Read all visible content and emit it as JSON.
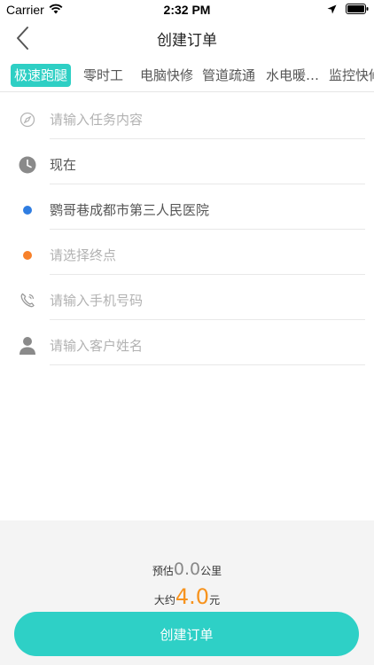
{
  "status_bar": {
    "carrier": "Carrier",
    "time": "2:32 PM"
  },
  "nav": {
    "title": "创建订单",
    "back_icon": "chevron-left-icon"
  },
  "tabs": [
    {
      "label": "极速跑腿",
      "active": true
    },
    {
      "label": "零时工",
      "active": false
    },
    {
      "label": "电脑快修",
      "active": false
    },
    {
      "label": "管道疏通",
      "active": false
    },
    {
      "label": "水电暖…",
      "active": false
    },
    {
      "label": "监控快修",
      "active": false
    }
  ],
  "form": {
    "task": {
      "placeholder": "请输入任务内容",
      "icon": "compass-icon"
    },
    "time": {
      "value": "现在",
      "icon": "clock-icon"
    },
    "start": {
      "value": "鹦哥巷成都市第三人民医院",
      "icon": "start-dot-icon",
      "color": "#2f7de1"
    },
    "end": {
      "placeholder": "请选择终点",
      "icon": "end-dot-icon",
      "color": "#f7812a"
    },
    "phone": {
      "placeholder": "请输入手机号码",
      "icon": "phone-icon"
    },
    "name": {
      "placeholder": "请输入客户姓名",
      "icon": "person-icon"
    }
  },
  "estimate": {
    "distance_prefix": "预估",
    "distance_value": "0.0",
    "distance_unit": "公里",
    "price_prefix": "大约",
    "price_value": "4.0",
    "price_unit": "元"
  },
  "submit": {
    "label": "创建订单"
  },
  "colors": {
    "accent": "#2ecfc4",
    "price": "#f7931e"
  }
}
